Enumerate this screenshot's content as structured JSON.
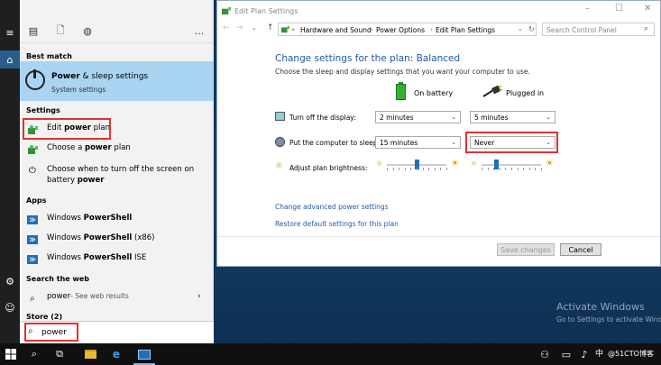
{
  "start_panel": {
    "tab_icons": [
      "document-list-icon",
      "file-icon",
      "globe-icon"
    ],
    "more": "...",
    "best_match_header": "Best match",
    "best_match": {
      "title_bold": "Power",
      "title_rest": " & sleep settings",
      "subtitle": "System settings"
    },
    "settings_header": "Settings",
    "settings_items": [
      {
        "pre": "Edit ",
        "bold": "power",
        "post": " plan"
      },
      {
        "pre": "Choose a ",
        "bold": "power",
        "post": " plan"
      },
      {
        "line1": "Choose when to turn off the screen on",
        "line2_pre": "battery ",
        "line2_bold": "power"
      }
    ],
    "apps_header": "Apps",
    "apps": [
      {
        "pre": "Windows ",
        "bold": "PowerShell",
        "post": ""
      },
      {
        "pre": "Windows ",
        "bold": "PowerShell",
        "post": " (x86)"
      },
      {
        "pre": "Windows ",
        "bold": "PowerShell",
        "post": " ISE"
      }
    ],
    "web_header": "Search the web",
    "web_item": {
      "text": "power",
      "suffix": " - See web results"
    },
    "store_header": "Store (2)",
    "search_value": "power"
  },
  "window": {
    "title": "Edit Plan Settings",
    "breadcrumb": [
      "Hardware and Sound",
      "Power Options",
      "Edit Plan Settings"
    ],
    "search_placeholder": "Search Control Panel",
    "heading": "Change settings for the plan: Balanced",
    "subheading": "Choose the sleep and display settings that you want your computer to use.",
    "col_battery": "On battery",
    "col_plugged": "Plugged in",
    "rows": [
      {
        "label": "Turn off the display:",
        "battery": "2 minutes",
        "plugged": "5 minutes"
      },
      {
        "label": "Put the computer to sleep:",
        "battery": "15 minutes",
        "plugged": "Never"
      }
    ],
    "brightness_label": "Adjust plan brightness:",
    "brightness_battery": 0.5,
    "brightness_plugged": 0.25,
    "link_advanced": "Change advanced power settings",
    "link_restore": "Restore default settings for this plan",
    "save_button": "Save changes",
    "cancel_button": "Cancel"
  },
  "watermark": {
    "line1": "Activate Windows",
    "line2": "Go to Settings to activate Windows."
  },
  "tray": {
    "ime": "中",
    "credit": "@51CTO博客"
  },
  "colors": {
    "accent_blue": "#1e5aa8",
    "best_match_bg": "#a9d4f2",
    "highlight_red": "#e03232"
  }
}
